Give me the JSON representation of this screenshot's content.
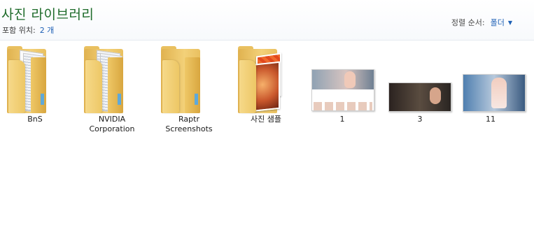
{
  "library": {
    "title": "사진 라이브러리",
    "includes_label": "포함 위치:",
    "includes_link": "2 개",
    "sort_label": "정렬 순서:",
    "sort_value": "폴더",
    "sort_caret": "▼"
  },
  "items": [
    {
      "label": "BnS",
      "type": "folder"
    },
    {
      "label": "NVIDIA Corporation",
      "type": "folder"
    },
    {
      "label": "Raptr Screenshots",
      "type": "folder"
    },
    {
      "label": "사진 샘플",
      "type": "folder-with-photos"
    },
    {
      "label": "1",
      "type": "image"
    },
    {
      "label": "3",
      "type": "image"
    },
    {
      "label": "11",
      "type": "image"
    }
  ],
  "icons": {
    "folder": "folder-icon",
    "image": "image-thumbnail"
  }
}
